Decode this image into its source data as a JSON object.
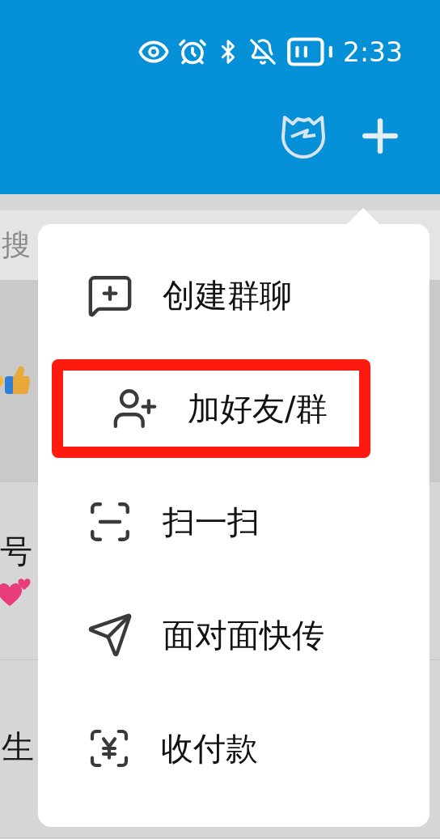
{
  "status_bar": {
    "time": "2:33"
  },
  "background_list": {
    "search_hint": "搜",
    "rows": [
      {
        "kind": "thumb",
        "selected": true
      },
      {
        "kind": "hearts",
        "title": "号",
        "selected": false
      },
      {
        "kind": "text",
        "title": "生",
        "selected": false
      }
    ]
  },
  "menu": {
    "items": [
      {
        "label": "创建群聊",
        "highlighted": false
      },
      {
        "label": "加好友/群",
        "highlighted": true
      },
      {
        "label": "扫一扫",
        "highlighted": false
      },
      {
        "label": "面对面快传",
        "highlighted": false
      },
      {
        "label": "收付款",
        "highlighted": false
      }
    ]
  }
}
